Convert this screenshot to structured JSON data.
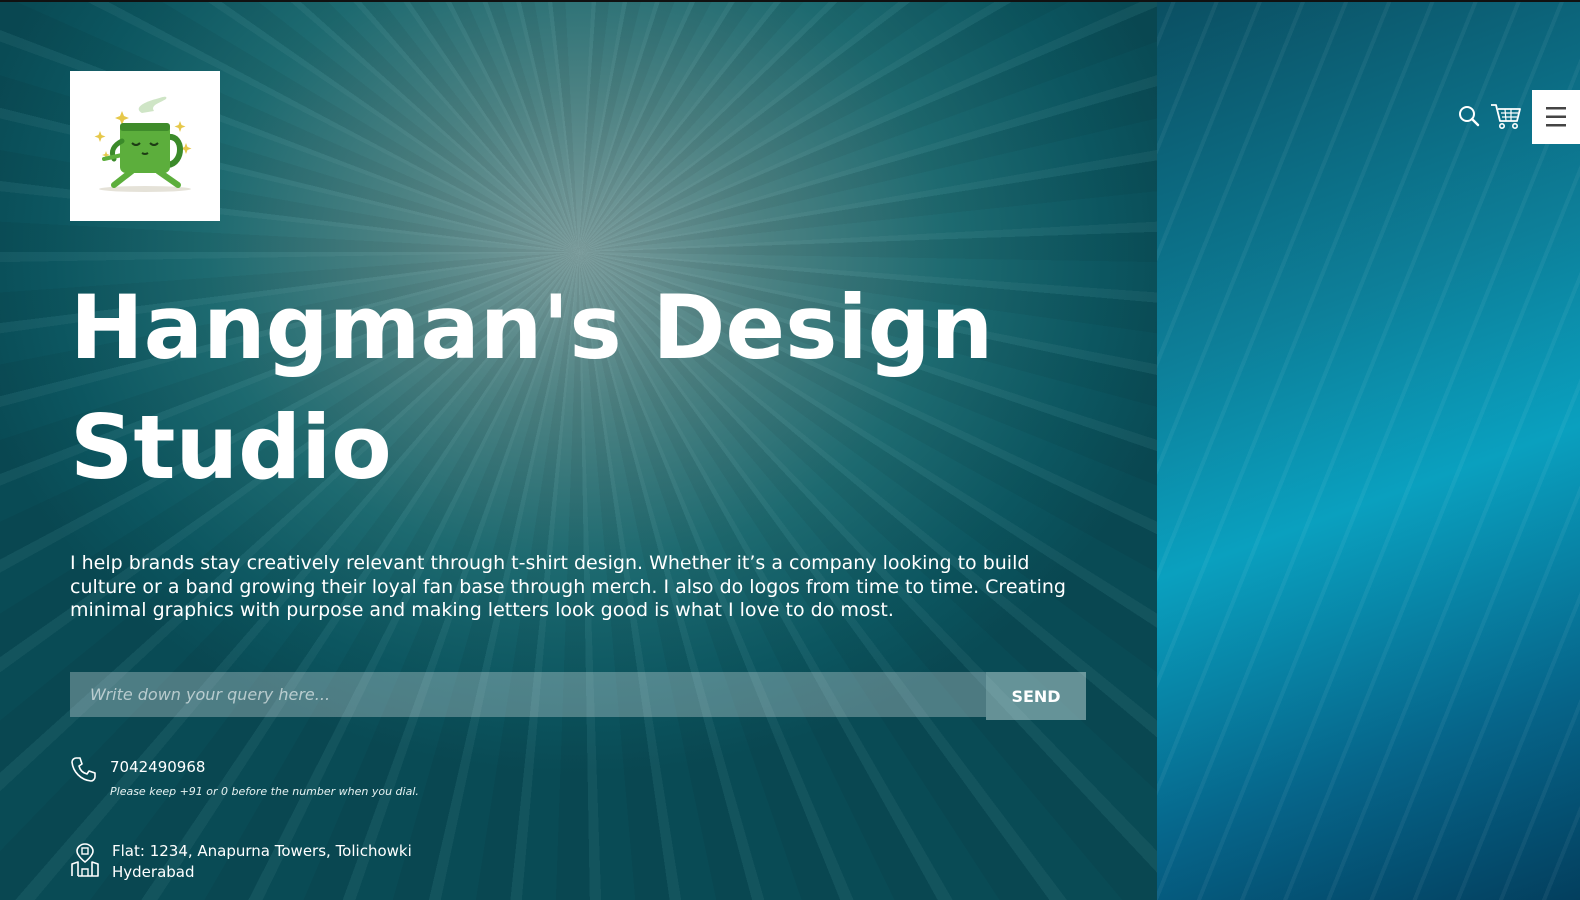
{
  "brand": {
    "title": "Hangman's Design Studio",
    "logo_icon": "yoga-mug-logo",
    "accent": "#0a8aa8"
  },
  "hero": {
    "description": "I help brands stay creatively relevant through t-shirt design. Whether it’s a company looking to build culture or a band growing their loyal fan base through merch. I also do logos from time to time. Creating minimal graphics with purpose and making letters look good is what I love to do most."
  },
  "query_form": {
    "placeholder": "Write down your query here...",
    "value": "",
    "send_label": "SEND"
  },
  "contact": {
    "phone_icon": "phone-icon",
    "phone": "7042490968",
    "phone_note": "Please keep +91 or 0 before the number when you dial.",
    "address_icon": "location-building-icon",
    "address_line1": "Flat: 1234, Anapurna Towers, Tolichowki",
    "address_line2": "Hyderabad"
  },
  "header": {
    "search_icon": "search-icon",
    "cart_icon": "cart-icon",
    "menu_icon": "hamburger-menu-icon"
  }
}
